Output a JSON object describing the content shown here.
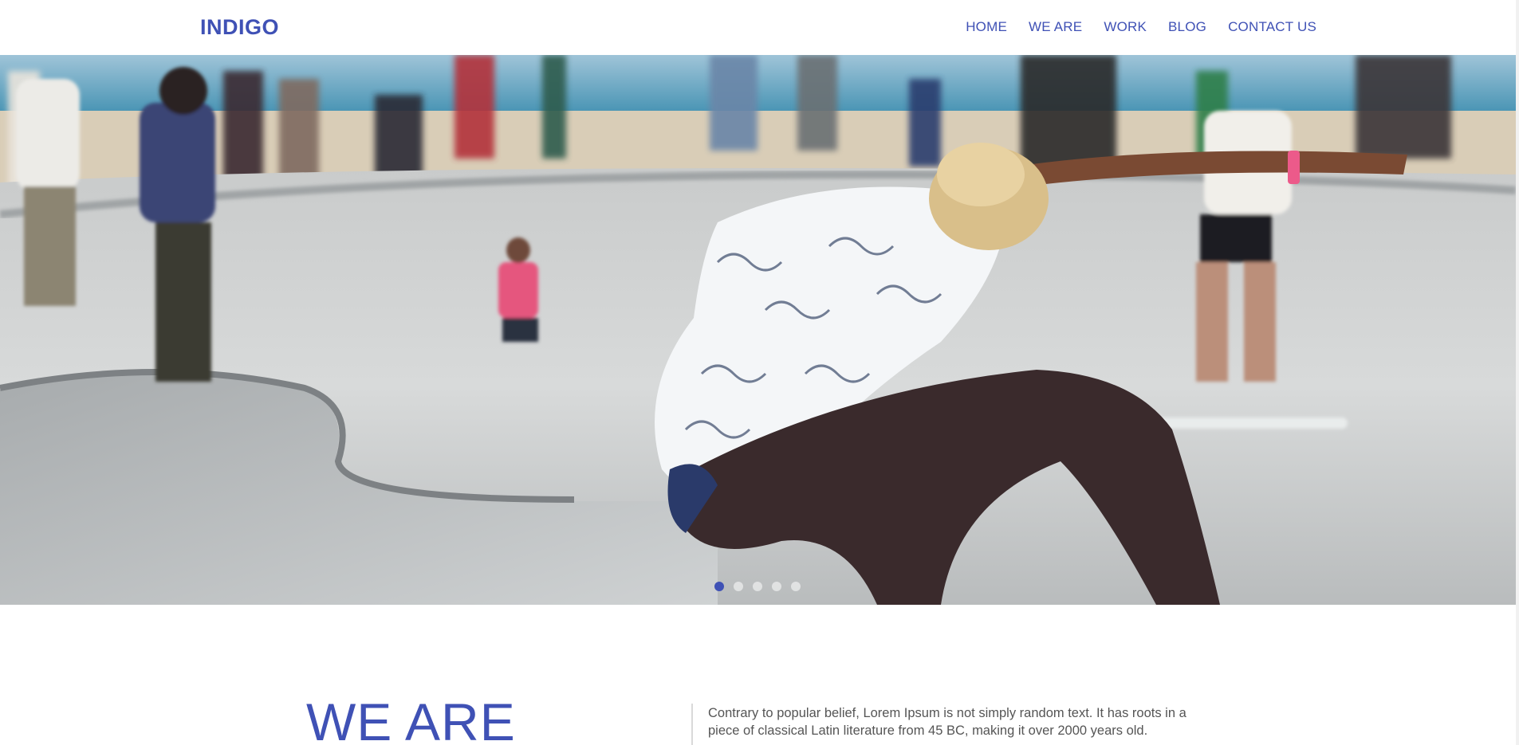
{
  "header": {
    "logo": "INDIGO",
    "nav": [
      "HOME",
      "WE ARE",
      "WORK",
      "BLOG",
      "CONTACT US"
    ]
  },
  "hero": {
    "slide_count": 5,
    "active_slide": 1,
    "image_subject": "skateboarder in skate park"
  },
  "we_are": {
    "title": "WE ARE",
    "text": "Contrary to popular belief, Lorem Ipsum is not simply random text. It has roots in a piece of classical Latin literature from 45 BC, making it over 2000 years old."
  },
  "colors": {
    "accent": "#3f51b5",
    "body_text": "#555555",
    "background": "#ffffff"
  }
}
